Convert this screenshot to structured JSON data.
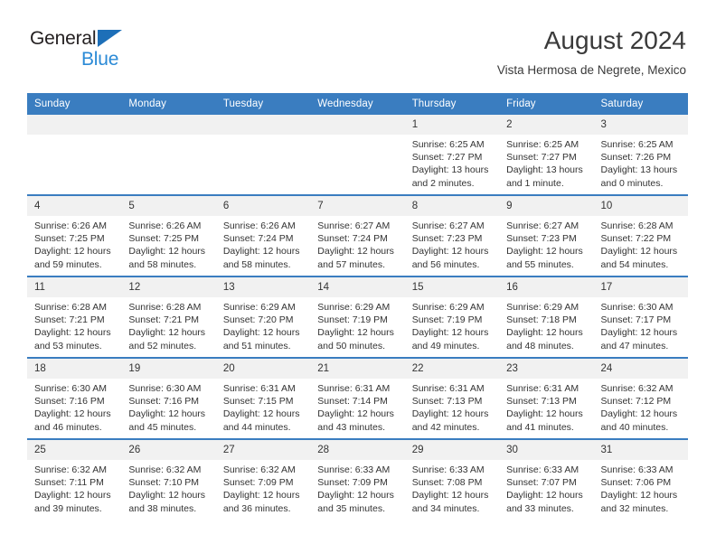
{
  "brand": {
    "name_part1": "General",
    "name_part2": "Blue",
    "logo_icon": "triangle-logo-icon"
  },
  "header": {
    "title": "August 2024",
    "subtitle": "Vista Hermosa de Negrete, Mexico"
  },
  "colors": {
    "header_blue": "#3a7dc0",
    "brand_blue": "#2b8ad6",
    "daynum_band": "#f1f1f1",
    "text": "#333333"
  },
  "weekdays": [
    "Sunday",
    "Monday",
    "Tuesday",
    "Wednesday",
    "Thursday",
    "Friday",
    "Saturday"
  ],
  "weeks": [
    [
      {
        "day": "",
        "empty": true,
        "sunrise": "",
        "sunset": "",
        "daylight_1": "",
        "daylight_2": ""
      },
      {
        "day": "",
        "empty": true,
        "sunrise": "",
        "sunset": "",
        "daylight_1": "",
        "daylight_2": ""
      },
      {
        "day": "",
        "empty": true,
        "sunrise": "",
        "sunset": "",
        "daylight_1": "",
        "daylight_2": ""
      },
      {
        "day": "",
        "empty": true,
        "sunrise": "",
        "sunset": "",
        "daylight_1": "",
        "daylight_2": ""
      },
      {
        "day": "1",
        "sunrise": "Sunrise: 6:25 AM",
        "sunset": "Sunset: 7:27 PM",
        "daylight_1": "Daylight: 13 hours",
        "daylight_2": "and 2 minutes."
      },
      {
        "day": "2",
        "sunrise": "Sunrise: 6:25 AM",
        "sunset": "Sunset: 7:27 PM",
        "daylight_1": "Daylight: 13 hours",
        "daylight_2": "and 1 minute."
      },
      {
        "day": "3",
        "sunrise": "Sunrise: 6:25 AM",
        "sunset": "Sunset: 7:26 PM",
        "daylight_1": "Daylight: 13 hours",
        "daylight_2": "and 0 minutes."
      }
    ],
    [
      {
        "day": "4",
        "sunrise": "Sunrise: 6:26 AM",
        "sunset": "Sunset: 7:25 PM",
        "daylight_1": "Daylight: 12 hours",
        "daylight_2": "and 59 minutes."
      },
      {
        "day": "5",
        "sunrise": "Sunrise: 6:26 AM",
        "sunset": "Sunset: 7:25 PM",
        "daylight_1": "Daylight: 12 hours",
        "daylight_2": "and 58 minutes."
      },
      {
        "day": "6",
        "sunrise": "Sunrise: 6:26 AM",
        "sunset": "Sunset: 7:24 PM",
        "daylight_1": "Daylight: 12 hours",
        "daylight_2": "and 58 minutes."
      },
      {
        "day": "7",
        "sunrise": "Sunrise: 6:27 AM",
        "sunset": "Sunset: 7:24 PM",
        "daylight_1": "Daylight: 12 hours",
        "daylight_2": "and 57 minutes."
      },
      {
        "day": "8",
        "sunrise": "Sunrise: 6:27 AM",
        "sunset": "Sunset: 7:23 PM",
        "daylight_1": "Daylight: 12 hours",
        "daylight_2": "and 56 minutes."
      },
      {
        "day": "9",
        "sunrise": "Sunrise: 6:27 AM",
        "sunset": "Sunset: 7:23 PM",
        "daylight_1": "Daylight: 12 hours",
        "daylight_2": "and 55 minutes."
      },
      {
        "day": "10",
        "sunrise": "Sunrise: 6:28 AM",
        "sunset": "Sunset: 7:22 PM",
        "daylight_1": "Daylight: 12 hours",
        "daylight_2": "and 54 minutes."
      }
    ],
    [
      {
        "day": "11",
        "sunrise": "Sunrise: 6:28 AM",
        "sunset": "Sunset: 7:21 PM",
        "daylight_1": "Daylight: 12 hours",
        "daylight_2": "and 53 minutes."
      },
      {
        "day": "12",
        "sunrise": "Sunrise: 6:28 AM",
        "sunset": "Sunset: 7:21 PM",
        "daylight_1": "Daylight: 12 hours",
        "daylight_2": "and 52 minutes."
      },
      {
        "day": "13",
        "sunrise": "Sunrise: 6:29 AM",
        "sunset": "Sunset: 7:20 PM",
        "daylight_1": "Daylight: 12 hours",
        "daylight_2": "and 51 minutes."
      },
      {
        "day": "14",
        "sunrise": "Sunrise: 6:29 AM",
        "sunset": "Sunset: 7:19 PM",
        "daylight_1": "Daylight: 12 hours",
        "daylight_2": "and 50 minutes."
      },
      {
        "day": "15",
        "sunrise": "Sunrise: 6:29 AM",
        "sunset": "Sunset: 7:19 PM",
        "daylight_1": "Daylight: 12 hours",
        "daylight_2": "and 49 minutes."
      },
      {
        "day": "16",
        "sunrise": "Sunrise: 6:29 AM",
        "sunset": "Sunset: 7:18 PM",
        "daylight_1": "Daylight: 12 hours",
        "daylight_2": "and 48 minutes."
      },
      {
        "day": "17",
        "sunrise": "Sunrise: 6:30 AM",
        "sunset": "Sunset: 7:17 PM",
        "daylight_1": "Daylight: 12 hours",
        "daylight_2": "and 47 minutes."
      }
    ],
    [
      {
        "day": "18",
        "sunrise": "Sunrise: 6:30 AM",
        "sunset": "Sunset: 7:16 PM",
        "daylight_1": "Daylight: 12 hours",
        "daylight_2": "and 46 minutes."
      },
      {
        "day": "19",
        "sunrise": "Sunrise: 6:30 AM",
        "sunset": "Sunset: 7:16 PM",
        "daylight_1": "Daylight: 12 hours",
        "daylight_2": "and 45 minutes."
      },
      {
        "day": "20",
        "sunrise": "Sunrise: 6:31 AM",
        "sunset": "Sunset: 7:15 PM",
        "daylight_1": "Daylight: 12 hours",
        "daylight_2": "and 44 minutes."
      },
      {
        "day": "21",
        "sunrise": "Sunrise: 6:31 AM",
        "sunset": "Sunset: 7:14 PM",
        "daylight_1": "Daylight: 12 hours",
        "daylight_2": "and 43 minutes."
      },
      {
        "day": "22",
        "sunrise": "Sunrise: 6:31 AM",
        "sunset": "Sunset: 7:13 PM",
        "daylight_1": "Daylight: 12 hours",
        "daylight_2": "and 42 minutes."
      },
      {
        "day": "23",
        "sunrise": "Sunrise: 6:31 AM",
        "sunset": "Sunset: 7:13 PM",
        "daylight_1": "Daylight: 12 hours",
        "daylight_2": "and 41 minutes."
      },
      {
        "day": "24",
        "sunrise": "Sunrise: 6:32 AM",
        "sunset": "Sunset: 7:12 PM",
        "daylight_1": "Daylight: 12 hours",
        "daylight_2": "and 40 minutes."
      }
    ],
    [
      {
        "day": "25",
        "sunrise": "Sunrise: 6:32 AM",
        "sunset": "Sunset: 7:11 PM",
        "daylight_1": "Daylight: 12 hours",
        "daylight_2": "and 39 minutes."
      },
      {
        "day": "26",
        "sunrise": "Sunrise: 6:32 AM",
        "sunset": "Sunset: 7:10 PM",
        "daylight_1": "Daylight: 12 hours",
        "daylight_2": "and 38 minutes."
      },
      {
        "day": "27",
        "sunrise": "Sunrise: 6:32 AM",
        "sunset": "Sunset: 7:09 PM",
        "daylight_1": "Daylight: 12 hours",
        "daylight_2": "and 36 minutes."
      },
      {
        "day": "28",
        "sunrise": "Sunrise: 6:33 AM",
        "sunset": "Sunset: 7:09 PM",
        "daylight_1": "Daylight: 12 hours",
        "daylight_2": "and 35 minutes."
      },
      {
        "day": "29",
        "sunrise": "Sunrise: 6:33 AM",
        "sunset": "Sunset: 7:08 PM",
        "daylight_1": "Daylight: 12 hours",
        "daylight_2": "and 34 minutes."
      },
      {
        "day": "30",
        "sunrise": "Sunrise: 6:33 AM",
        "sunset": "Sunset: 7:07 PM",
        "daylight_1": "Daylight: 12 hours",
        "daylight_2": "and 33 minutes."
      },
      {
        "day": "31",
        "sunrise": "Sunrise: 6:33 AM",
        "sunset": "Sunset: 7:06 PM",
        "daylight_1": "Daylight: 12 hours",
        "daylight_2": "and 32 minutes."
      }
    ]
  ]
}
